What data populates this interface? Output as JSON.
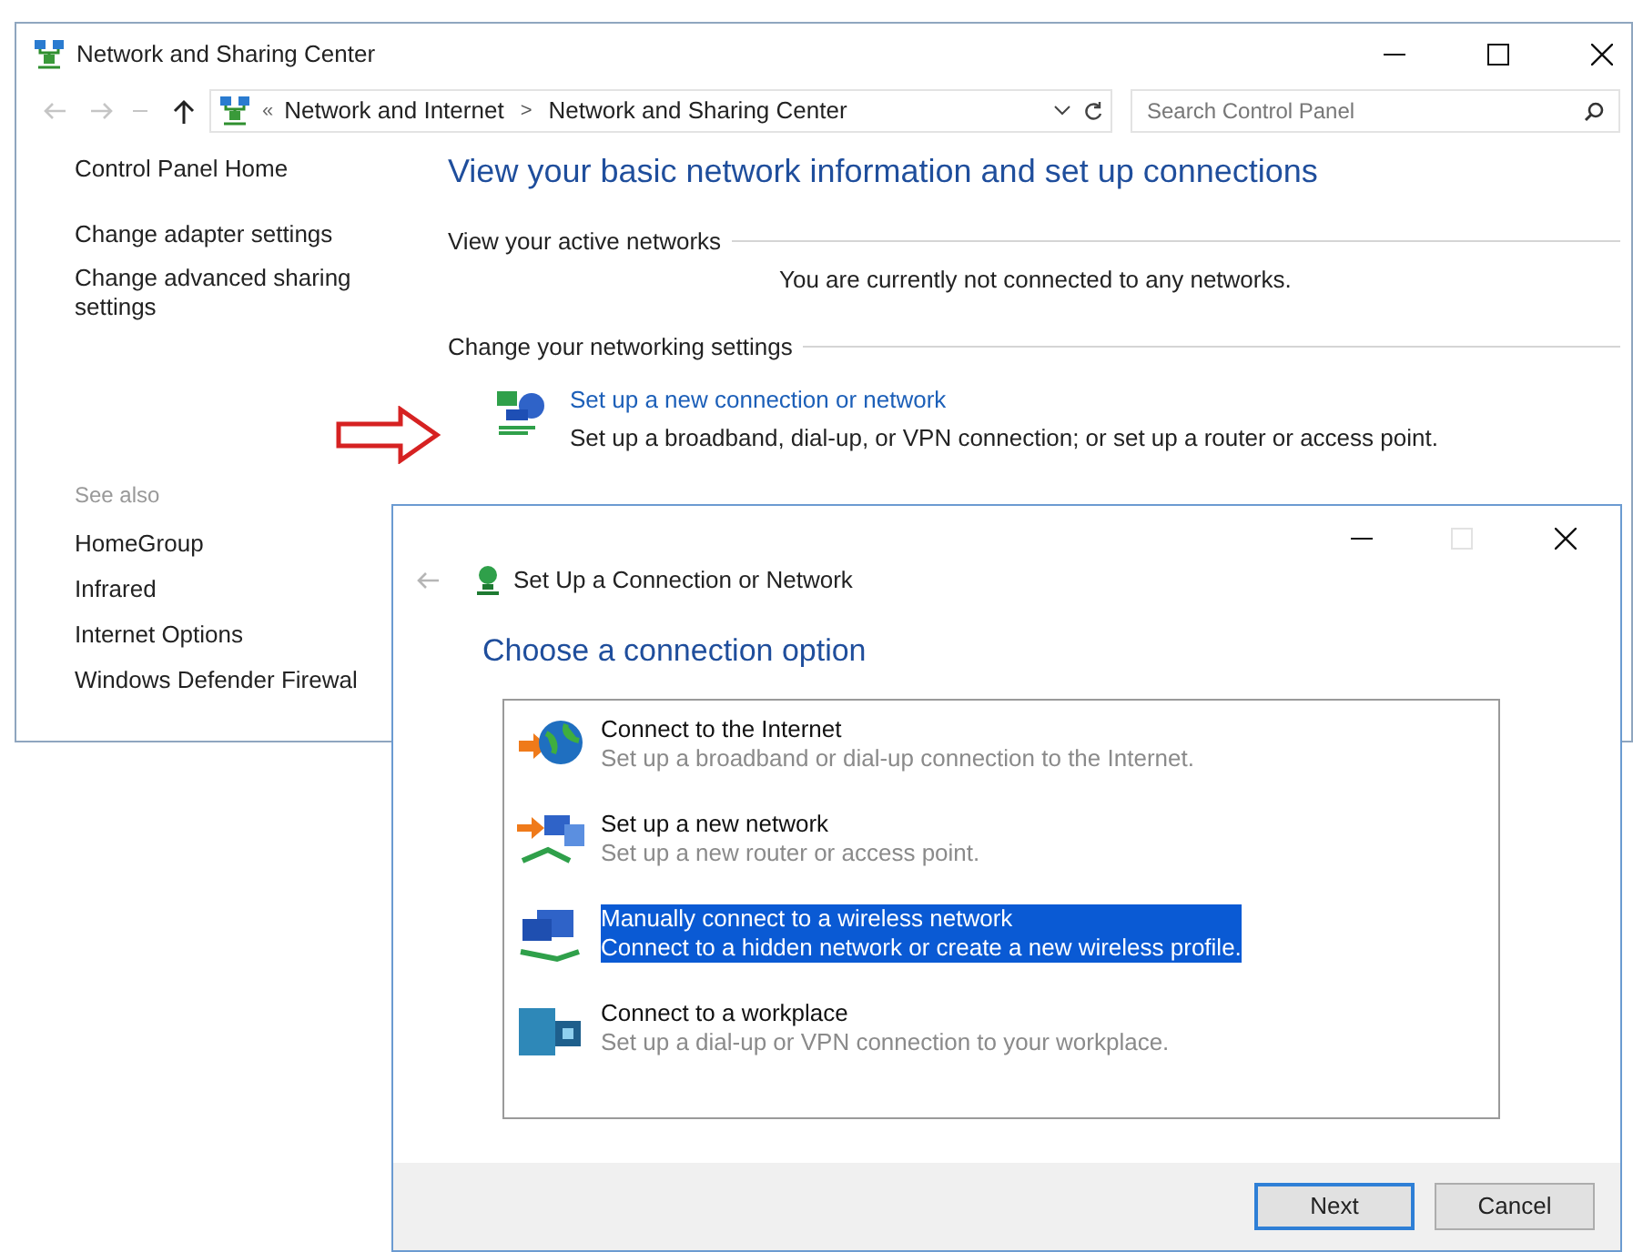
{
  "main_window": {
    "title": "Network and Sharing Center",
    "address_bar": {
      "overflow": "«",
      "separator": ">",
      "breadcrumbs": [
        "Network and Internet",
        "Network and Sharing Center"
      ]
    },
    "search": {
      "placeholder": "Search Control Panel"
    },
    "sidebar": {
      "links": [
        "Control Panel Home",
        "Change adapter settings",
        "Change advanced sharing settings"
      ],
      "see_also_label": "See also",
      "see_also": [
        "HomeGroup",
        "Infrared",
        "Internet Options",
        "Windows Defender Firewal"
      ]
    },
    "content": {
      "heading": "View your basic network information and set up connections",
      "sections": [
        {
          "title": "View your active networks",
          "text": "You are currently not connected to any networks."
        },
        {
          "title": "Change your networking settings"
        }
      ],
      "task": {
        "link": "Set up a new connection or network",
        "description": "Set up a broadband, dial-up, or VPN connection; or set up a router or access point."
      }
    }
  },
  "dialog": {
    "title": "Set Up a Connection or Network",
    "maximize_disabled": true,
    "heading": "Choose a connection option",
    "options": [
      {
        "title": "Connect to the Internet",
        "description": "Set up a broadband or dial-up connection to the Internet.",
        "selected": false
      },
      {
        "title": "Set up a new network",
        "description": "Set up a new router or access point.",
        "selected": false
      },
      {
        "title": "Manually connect to a wireless network",
        "description": "Connect to a hidden network or create a new wireless profile.",
        "selected": true
      },
      {
        "title": "Connect to a workplace",
        "description": "Set up a dial-up or VPN connection to your workplace.",
        "selected": false
      }
    ],
    "buttons": [
      {
        "label": "Next",
        "default": true
      },
      {
        "label": "Cancel",
        "default": false
      }
    ]
  }
}
